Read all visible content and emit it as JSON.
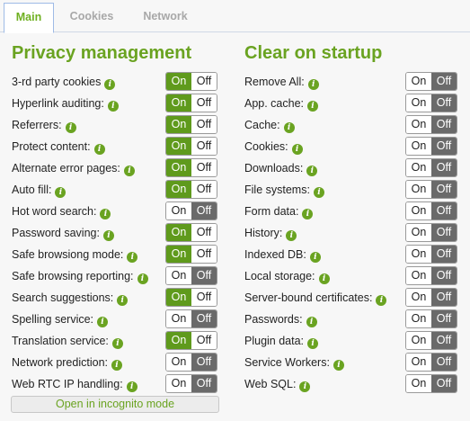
{
  "tabs": [
    {
      "label": "Main",
      "active": true
    },
    {
      "label": "Cookies",
      "active": false
    },
    {
      "label": "Network",
      "active": false
    }
  ],
  "privacy": {
    "title": "Privacy management",
    "rows": [
      {
        "label": "3-rd party cookies",
        "state": "on"
      },
      {
        "label": "Hyperlink auditing:",
        "state": "on"
      },
      {
        "label": "Referrers:",
        "state": "on"
      },
      {
        "label": "Protect content:",
        "state": "on"
      },
      {
        "label": "Alternate error pages:",
        "state": "on"
      },
      {
        "label": "Auto fill:",
        "state": "on"
      },
      {
        "label": "Hot word search:",
        "state": "off"
      },
      {
        "label": "Password saving:",
        "state": "on"
      },
      {
        "label": "Safe browsiong mode:",
        "state": "on"
      },
      {
        "label": "Safe browsing reporting:",
        "state": "off"
      },
      {
        "label": "Search suggestions:",
        "state": "on"
      },
      {
        "label": "Spelling service:",
        "state": "off"
      },
      {
        "label": "Translation service:",
        "state": "on"
      },
      {
        "label": "Network prediction:",
        "state": "off"
      },
      {
        "label": "Web RTC IP handling:",
        "state": "off"
      }
    ],
    "incognito_button": "Open in incognito mode"
  },
  "clear": {
    "title": "Clear on startup",
    "rows": [
      {
        "label": "Remove All:",
        "state": "off"
      },
      {
        "label": "App. cache:",
        "state": "off"
      },
      {
        "label": "Cache:",
        "state": "off"
      },
      {
        "label": "Cookies:",
        "state": "off"
      },
      {
        "label": "Downloads:",
        "state": "off"
      },
      {
        "label": "File systems:",
        "state": "off"
      },
      {
        "label": "Form data:",
        "state": "off"
      },
      {
        "label": "History:",
        "state": "off"
      },
      {
        "label": "Indexed DB:",
        "state": "off"
      },
      {
        "label": "Local storage:",
        "state": "off"
      },
      {
        "label": "Server-bound certificates:",
        "state": "off"
      },
      {
        "label": "Passwords:",
        "state": "off"
      },
      {
        "label": "Plugin data:",
        "state": "off"
      },
      {
        "label": "Service Workers:",
        "state": "off"
      },
      {
        "label": "Web SQL:",
        "state": "off"
      }
    ]
  },
  "toggle_labels": {
    "on": "On",
    "off": "Off"
  },
  "icons": {
    "info": "info-icon"
  },
  "colors": {
    "accent": "#6aa321",
    "on_active": "#5f9a1c",
    "off_active": "#6a6a6a"
  }
}
